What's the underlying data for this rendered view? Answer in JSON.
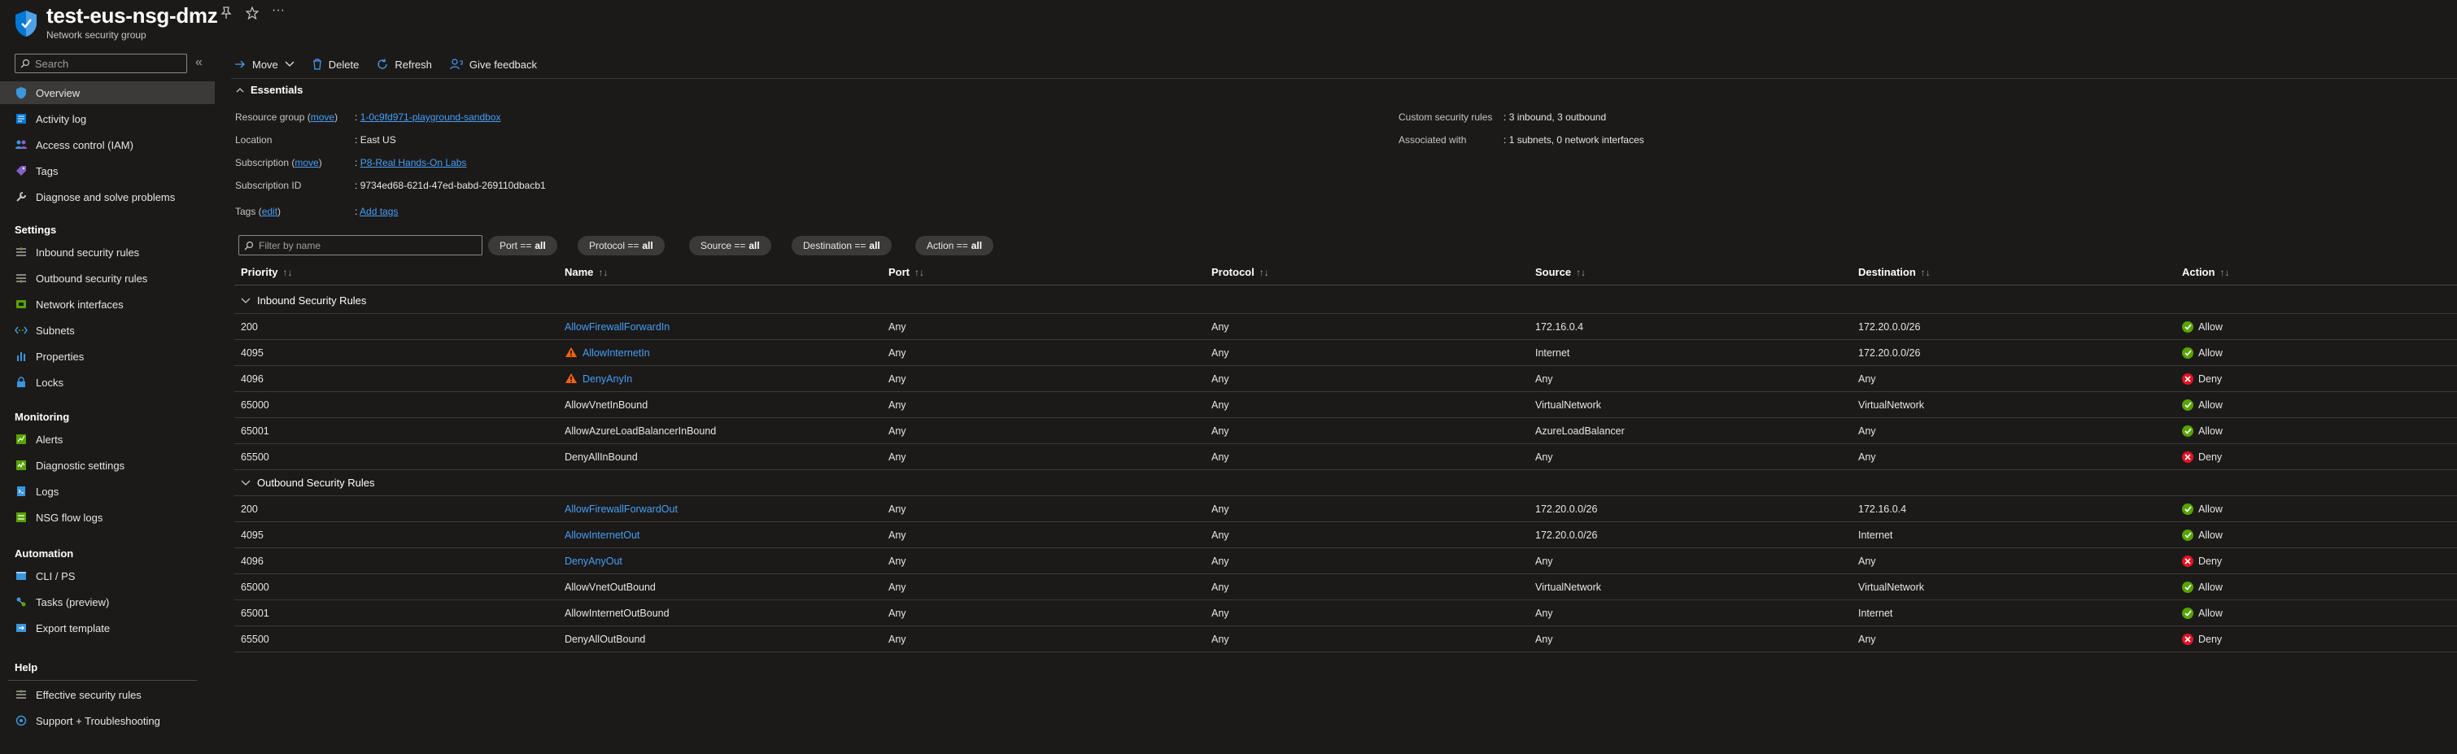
{
  "header": {
    "title": "test-eus-nsg-dmz",
    "subtitle": "Network security group"
  },
  "sidebar": {
    "search_placeholder": "Search",
    "items": [
      {
        "label": "Overview",
        "icon": "overview-icon",
        "active": true
      },
      {
        "label": "Activity log",
        "icon": "activity-log-icon"
      },
      {
        "label": "Access control (IAM)",
        "icon": "iam-icon"
      },
      {
        "label": "Tags",
        "icon": "tag-icon"
      },
      {
        "label": "Diagnose and solve problems",
        "icon": "wrench-icon"
      }
    ],
    "sections": [
      {
        "title": "Settings",
        "items": [
          {
            "label": "Inbound security rules",
            "icon": "inbound-rules-icon"
          },
          {
            "label": "Outbound security rules",
            "icon": "outbound-rules-icon"
          },
          {
            "label": "Network interfaces",
            "icon": "nic-icon"
          },
          {
            "label": "Subnets",
            "icon": "subnet-icon"
          },
          {
            "label": "Properties",
            "icon": "properties-icon"
          },
          {
            "label": "Locks",
            "icon": "lock-icon"
          }
        ]
      },
      {
        "title": "Monitoring",
        "items": [
          {
            "label": "Alerts",
            "icon": "alert-icon"
          },
          {
            "label": "Diagnostic settings",
            "icon": "diagnostic-icon"
          },
          {
            "label": "Logs",
            "icon": "logs-icon"
          },
          {
            "label": "NSG flow logs",
            "icon": "flow-logs-icon"
          }
        ]
      },
      {
        "title": "Automation",
        "items": [
          {
            "label": "CLI / PS",
            "icon": "cli-icon"
          },
          {
            "label": "Tasks (preview)",
            "icon": "tasks-icon"
          },
          {
            "label": "Export template",
            "icon": "export-icon"
          }
        ]
      },
      {
        "title": "Help",
        "items": [
          {
            "label": "Effective security rules",
            "icon": "effective-rules-icon"
          },
          {
            "label": "Support + Troubleshooting",
            "icon": "support-icon"
          }
        ]
      }
    ]
  },
  "toolbar": {
    "move": "Move",
    "delete": "Delete",
    "refresh": "Refresh",
    "feedback": "Give feedback"
  },
  "essentials": {
    "toggle_label": "Essentials",
    "resource_group_label": "Resource group (",
    "move_link": "move",
    "label_close": ")",
    "resource_group_value": "1-0c9fd971-playground-sandbox",
    "location_label": "Location",
    "location_value": "East US",
    "subscription_label": "Subscription (",
    "subscription_value": "P8-Real Hands-On Labs",
    "subscription_id_label": "Subscription ID",
    "subscription_id_value": "9734ed68-621d-47ed-babd-269110dbacb1",
    "tags_label": "Tags (",
    "edit_link": "edit",
    "tags_value": "Add tags",
    "custom_rules_label": "Custom security rules",
    "custom_rules_value": "3 inbound, 3 outbound",
    "associated_label": "Associated with",
    "associated_value": "1 subnets, 0 network interfaces",
    "colon": ":"
  },
  "filters": {
    "placeholder": "Filter by name",
    "pills": [
      {
        "key": "Port ==",
        "value": "all"
      },
      {
        "key": "Protocol ==",
        "value": "all"
      },
      {
        "key": "Source ==",
        "value": "all"
      },
      {
        "key": "Destination ==",
        "value": "all"
      },
      {
        "key": "Action ==",
        "value": "all"
      }
    ]
  },
  "table": {
    "columns": [
      "Priority",
      "Name",
      "Port",
      "Protocol",
      "Source",
      "Destination",
      "Action"
    ],
    "sort_glyph": "↑↓",
    "groups": [
      {
        "title": "Inbound Security Rules",
        "rows": [
          {
            "priority": "200",
            "name": "AllowFirewallForwardIn",
            "link": true,
            "warn": false,
            "port": "Any",
            "protocol": "Any",
            "source": "172.16.0.4",
            "destination": "172.20.0.0/26",
            "action": "Allow"
          },
          {
            "priority": "4095",
            "name": "AllowInternetIn",
            "link": true,
            "warn": true,
            "port": "Any",
            "protocol": "Any",
            "source": "Internet",
            "destination": "172.20.0.0/26",
            "action": "Allow"
          },
          {
            "priority": "4096",
            "name": "DenyAnyIn",
            "link": true,
            "warn": true,
            "port": "Any",
            "protocol": "Any",
            "source": "Any",
            "destination": "Any",
            "action": "Deny"
          },
          {
            "priority": "65000",
            "name": "AllowVnetInBound",
            "link": false,
            "warn": false,
            "port": "Any",
            "protocol": "Any",
            "source": "VirtualNetwork",
            "destination": "VirtualNetwork",
            "action": "Allow"
          },
          {
            "priority": "65001",
            "name": "AllowAzureLoadBalancerInBound",
            "link": false,
            "warn": false,
            "port": "Any",
            "protocol": "Any",
            "source": "AzureLoadBalancer",
            "destination": "Any",
            "action": "Allow"
          },
          {
            "priority": "65500",
            "name": "DenyAllInBound",
            "link": false,
            "warn": false,
            "port": "Any",
            "protocol": "Any",
            "source": "Any",
            "destination": "Any",
            "action": "Deny"
          }
        ]
      },
      {
        "title": "Outbound Security Rules",
        "rows": [
          {
            "priority": "200",
            "name": "AllowFirewallForwardOut",
            "link": true,
            "warn": false,
            "port": "Any",
            "protocol": "Any",
            "source": "172.20.0.0/26",
            "destination": "172.16.0.4",
            "action": "Allow"
          },
          {
            "priority": "4095",
            "name": "AllowInternetOut",
            "link": true,
            "warn": false,
            "port": "Any",
            "protocol": "Any",
            "source": "172.20.0.0/26",
            "destination": "Internet",
            "action": "Allow"
          },
          {
            "priority": "4096",
            "name": "DenyAnyOut",
            "link": true,
            "warn": false,
            "port": "Any",
            "protocol": "Any",
            "source": "Any",
            "destination": "Any",
            "action": "Deny"
          },
          {
            "priority": "65000",
            "name": "AllowVnetOutBound",
            "link": false,
            "warn": false,
            "port": "Any",
            "protocol": "Any",
            "source": "VirtualNetwork",
            "destination": "VirtualNetwork",
            "action": "Allow"
          },
          {
            "priority": "65001",
            "name": "AllowInternetOutBound",
            "link": false,
            "warn": false,
            "port": "Any",
            "protocol": "Any",
            "source": "Any",
            "destination": "Internet",
            "action": "Allow"
          },
          {
            "priority": "65500",
            "name": "DenyAllOutBound",
            "link": false,
            "warn": false,
            "port": "Any",
            "protocol": "Any",
            "source": "Any",
            "destination": "Any",
            "action": "Deny"
          }
        ]
      }
    ]
  },
  "colors": {
    "allow": "#57a300",
    "deny": "#e81123",
    "warning": "#f7630c",
    "link": "#479ef5"
  }
}
